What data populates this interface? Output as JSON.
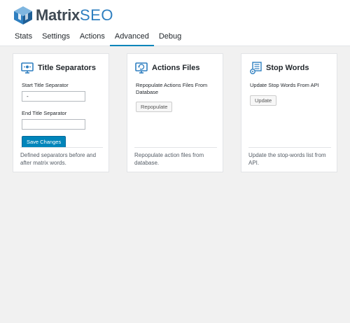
{
  "brand": {
    "name": "Matrix",
    "suffix": "SEO",
    "logo_icon": "cube-logo-icon",
    "accent": "#2e7fc0"
  },
  "tabs": [
    {
      "label": "Stats",
      "active": false
    },
    {
      "label": "Settings",
      "active": false
    },
    {
      "label": "Actions",
      "active": false
    },
    {
      "label": "Advanced",
      "active": true
    },
    {
      "label": "Debug",
      "active": false
    }
  ],
  "cards": {
    "separators": {
      "icon": "monitor-icon",
      "title": "Title Separators",
      "start_label": "Start Title Separator",
      "start_value": "-",
      "end_label": "End Title Separator",
      "end_value": "",
      "save_label": "Save Changes",
      "footer": "Defined separators before and after matrix words."
    },
    "actions": {
      "icon": "refresh-monitor-icon",
      "title": "Actions Files",
      "description": "Repopulate Actions Files From Database",
      "button_label": "Repopulate",
      "footer": "Repopulate action files from database."
    },
    "stopwords": {
      "icon": "list-gear-icon",
      "title": "Stop Words",
      "description": "Update Stop Words From API",
      "button_label": "Update",
      "footer": "Update the stop-words list from API."
    }
  },
  "colors": {
    "primary_button": "#0085ba",
    "active_tab_underline": "#0085ba",
    "icon_blue": "#2e7fc0"
  }
}
